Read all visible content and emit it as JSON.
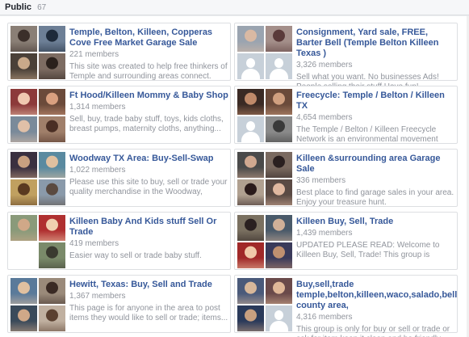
{
  "header": {
    "title": "Public",
    "count": "67"
  },
  "groups": [
    {
      "name": "Temple, Belton, Killeen, Copperas Cove Free Market Garage Sale",
      "members": "221 members",
      "description": "This site was created to help free thinkers of Temple and surrounding areas connect. You...",
      "thumbs": [
        {
          "bg": "#8a7f76",
          "fg": "#3b2f2a"
        },
        {
          "bg": "#6d7f96",
          "fg": "#1e2a3a"
        },
        {
          "bg": "#4a4038",
          "fg": "#c9a98a"
        },
        {
          "bg": "#7d6c62",
          "fg": "#2b211c"
        }
      ]
    },
    {
      "name": "Consignment, Yard sale, FREE, Barter Bell (Temple Belton Killeen Texas )",
      "members": "3,326 members",
      "description": "Sell what you want. No businesses Ads! People selling their stuff Have fun!",
      "thumbs": [
        {
          "bg": "#9aa4b0",
          "fg": "#d9b9a3"
        },
        {
          "bg": "#a48f8a",
          "fg": "#5a3a3a"
        },
        {
          "silhouette": true
        },
        {
          "silhouette": true
        }
      ]
    },
    {
      "name": "Ft Hood/Killeen Mommy & Baby Shop",
      "members": "1,314 members",
      "description": "Sell, buy, trade baby stuff, toys, kids cloths, breast pumps, maternity cloths, anything...",
      "thumbs": [
        {
          "bg": "#8c3a3a",
          "fg": "#f0c8b0"
        },
        {
          "bg": "#6b4a3a",
          "fg": "#d9a080"
        },
        {
          "bg": "#7a8a9a",
          "fg": "#e0c0a8"
        },
        {
          "bg": "#a07f6a",
          "fg": "#4a2e24"
        }
      ]
    },
    {
      "name": "Freecycle: Temple / Belton / Killeen TX",
      "members": "4,654 members",
      "description": "The Temple / Belton / Killeen Freecycle Network is an environmental movement where you...",
      "thumbs": [
        {
          "bg": "#3a2a24",
          "fg": "#c08a6a"
        },
        {
          "bg": "#6a4a3a",
          "fg": "#d0a080"
        },
        {
          "silhouette": true
        },
        {
          "bg": "#8a8a8a",
          "fg": "#3a3a3a"
        }
      ]
    },
    {
      "name": "Woodway TX Area: Buy-Sell-Swap",
      "members": "1,022 members",
      "description": "Please use this site to buy, sell or trade your quality merchandise in the Woodway, Texas...",
      "thumbs": [
        {
          "bg": "#3a3040",
          "fg": "#c8a080"
        },
        {
          "bg": "#5a8aa0",
          "fg": "#e0c0a0"
        },
        {
          "bg": "#c0a060",
          "fg": "#5a3a20"
        },
        {
          "bg": "#8a9aaa",
          "fg": "#5a4a40"
        }
      ]
    },
    {
      "name": "Killeen &surrounding area Garage Sale",
      "members": "336 members",
      "description": "Best place to find garage sales in your area. Enjoy your treasure hunt.",
      "thumbs": [
        {
          "bg": "#4a4a4a",
          "fg": "#d0a890"
        },
        {
          "bg": "#7a6a60",
          "fg": "#2a2020"
        },
        {
          "bg": "#b0a090",
          "fg": "#2a1a1a"
        },
        {
          "bg": "#5a4a44",
          "fg": "#e0b8a0"
        }
      ]
    },
    {
      "name": "Killeen Baby And Kids stuff Sell Or Trade",
      "members": "419 members",
      "description": "Easier way to sell or trade baby stuff.",
      "thumbs": [
        {
          "bg": "#8a9a7a",
          "fg": "#d0a888"
        },
        {
          "bg": "#b03030",
          "fg": "#f0d0b0"
        },
        {
          "bg": "#ffffff",
          "fg": "#ffffff"
        },
        {
          "bg": "#7a8a6a",
          "fg": "#3a3a30"
        }
      ]
    },
    {
      "name": "Killeen Buy, Sell, Trade",
      "members": "1,439 members",
      "description": "UPDATED PLEASE READ: Welcome to Killeen Buy, Sell, Trade! This group is designed to help...",
      "thumbs": [
        {
          "bg": "#7a7060",
          "fg": "#2a2020"
        },
        {
          "bg": "#4a5a6a",
          "fg": "#d0b098"
        },
        {
          "bg": "#a02828",
          "fg": "#f0c8a8"
        },
        {
          "bg": "#3a3a5a",
          "fg": "#c09070"
        }
      ]
    },
    {
      "name": "Hewitt, Texas: Buy, Sell and Trade",
      "members": "1,367 members",
      "description": "This page is for anyone in the area to post items they would like to sell or trade; items...",
      "thumbs": [
        {
          "bg": "#5a7a9a",
          "fg": "#e0c0a0"
        },
        {
          "bg": "#9a8a7a",
          "fg": "#3a2a24"
        },
        {
          "bg": "#3a4a5a",
          "fg": "#d0a888"
        },
        {
          "bg": "#c0b0a0",
          "fg": "#5a4030"
        }
      ]
    },
    {
      "name": "Buy,sell,trade temple,belton,killeen,waco,salado,bell county area,",
      "members": "4,316 members",
      "description": "This group is only for buy or sell or trade or ask for item keep it clean and be friendly...",
      "thumbs": [
        {
          "bg": "#4a5a7a",
          "fg": "#d8b89a"
        },
        {
          "bg": "#6a4a4a",
          "fg": "#e0b898"
        },
        {
          "bg": "#2a3a5a",
          "fg": "#c8a080"
        },
        {
          "silhouette": true
        }
      ]
    }
  ]
}
